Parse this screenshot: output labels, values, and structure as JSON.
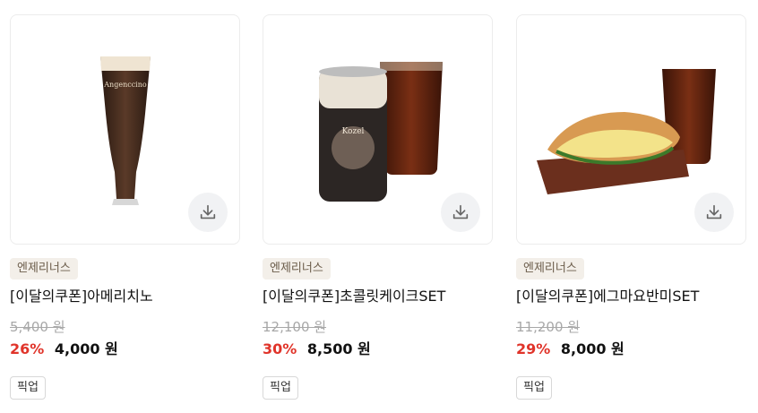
{
  "products": [
    {
      "brand": "엔제리너스",
      "title": "[이달의쿠폰]아메리치노",
      "original_price": "5,400 원",
      "discount": "26%",
      "price": "4,000 원",
      "tag": "픽업",
      "image": {
        "label": "Angenccino"
      }
    },
    {
      "brand": "엔제리너스",
      "title": "[이달의쿠폰]초콜릿케이크SET",
      "original_price": "12,100 원",
      "discount": "30%",
      "price": "8,500 원",
      "tag": "픽업",
      "image": {
        "label": "Kozel"
      }
    },
    {
      "brand": "엔제리너스",
      "title": "[이달의쿠폰]에그마요반미SET",
      "original_price": "11,200 원",
      "discount": "29%",
      "price": "8,000 원",
      "tag": "픽업",
      "image": {}
    }
  ],
  "icons": {
    "download": "download-icon"
  },
  "colors": {
    "discount": "#e0342a",
    "brand_chip_bg": "#f3efe9",
    "brand_chip_text": "#6b5c4a"
  }
}
